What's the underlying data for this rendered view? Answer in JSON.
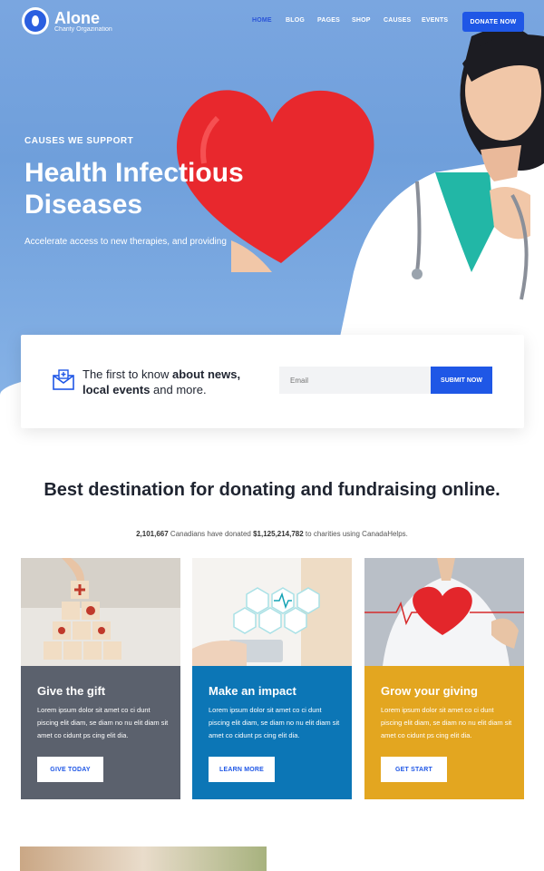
{
  "brand": {
    "name": "Alone",
    "tagline": "Charity Orgazination"
  },
  "nav": {
    "items": [
      "HOME",
      "BLOG",
      "PAGES",
      "SHOP",
      "CAUSES",
      "EVENTS"
    ],
    "active": "HOME",
    "donate_label": "DONATE NOW"
  },
  "hero": {
    "kicker": "CAUSES WE SUPPORT",
    "title": "Health Infectious Diseases",
    "desc": "Accelerate access to new therapies, and providing"
  },
  "subscribe": {
    "text_prefix": "The first to know ",
    "text_bold": "about news, local events",
    "text_suffix": " and more.",
    "email_placeholder": "Email",
    "submit_label": "SUBMIT NOW"
  },
  "section": {
    "title": "Best destination for donating and fundraising online.",
    "count1": "2,101,667",
    "mid1": " Canadians have donated ",
    "count2": "$1,125,214,782",
    "mid2": " to charities using CanadaHelps."
  },
  "cards": [
    {
      "title": "Give the gift",
      "text": "Lorem ipsum dolor sit amet co ci dunt piscing elit diam, se diam no nu elit diam sit amet co cidunt ps cing elit dia.",
      "button": "GIVE TODAY",
      "color": "#5b616d"
    },
    {
      "title": "Make an impact",
      "text": "Lorem ipsum dolor sit amet co ci dunt piscing elit diam, se diam no nu elit diam sit amet co cidunt ps cing elit dia.",
      "button": "LEARN MORE",
      "color": "#0c76b6"
    },
    {
      "title": "Grow your giving",
      "text": "Lorem ipsum dolor sit amet co ci dunt piscing elit diam, se diam no nu elit diam sit amet co cidunt ps cing elit dia.",
      "button": "GET START",
      "color": "#e3a620"
    }
  ],
  "colors": {
    "accent": "#1f57e6",
    "hero_blue": "#7aa6e0"
  }
}
